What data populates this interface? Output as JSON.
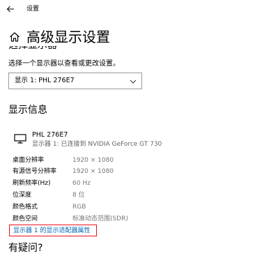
{
  "window": {
    "title": "设置"
  },
  "header": {
    "title": "高级显示设置"
  },
  "select_display": {
    "heading": "选择显示器",
    "description": "选择一个显示器以查看或更改设置。",
    "selected_value": "显示 1: PHL 276E7"
  },
  "display_info": {
    "heading": "显示信息",
    "monitor_name": "PHL 276E7",
    "monitor_connection": "显示器 1: 已连接到 NVIDIA GeForce GT 730",
    "rows": [
      {
        "label": "桌面分辨率",
        "value": "1920 × 1080"
      },
      {
        "label": "有源信号分辨率",
        "value": "1920 × 1080"
      },
      {
        "label": "刷新频率(Hz)",
        "value": "60 Hz"
      },
      {
        "label": "位深度",
        "value": "8 位"
      },
      {
        "label": "颜色格式",
        "value": "RGB"
      },
      {
        "label": "颜色空间",
        "value": "标准动态范围(SDR)"
      }
    ],
    "adapter_link": "显示器 1 的显示适配器属性"
  },
  "help": {
    "heading": "有疑问?"
  },
  "icons": {
    "back": "back-arrow-icon",
    "home": "home-icon",
    "monitor": "monitor-icon",
    "dropdown": "chevron-down-icon"
  },
  "colors": {
    "link": "#0066b4",
    "highlight_border": "#e8121a",
    "secondary_text": "#777777"
  }
}
